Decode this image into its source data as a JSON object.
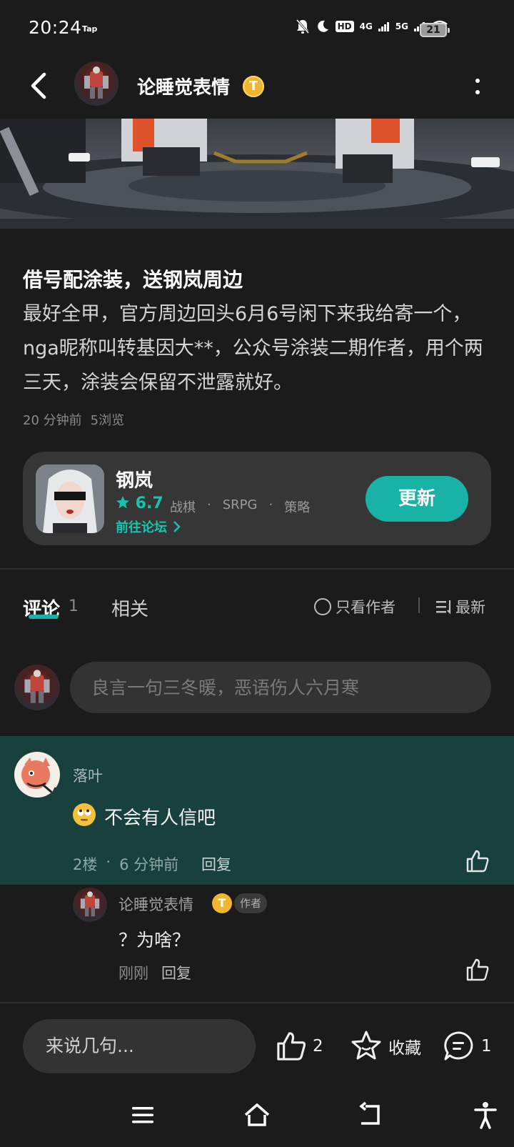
{
  "status_bar": {
    "time": "20:24",
    "tap": "Tap",
    "hd_badge": "HD",
    "net_4g": "4G",
    "net_5g": "5G",
    "battery": "21"
  },
  "header": {
    "title": "论睡觉表情",
    "badge": "T"
  },
  "post": {
    "title": "借号配涂装，送钢岚周边",
    "body": "最好全甲，官方周边回头6月6号闲下来我给寄一个，nga昵称叫转基因大**，公众号涂装二期作者，用个两三天，涂装会保留不泄露就好。",
    "time": "20 分钟前",
    "views": "5浏览"
  },
  "game_card": {
    "name": "钢岚",
    "rating": "6.7",
    "tags": [
      "战棋",
      "·",
      "SRPG",
      "·",
      "策略"
    ],
    "forum_link": "前往论坛",
    "update_button": "更新",
    "accent": "#18b3a6"
  },
  "tabs": {
    "comments_label": "评论",
    "comments_count": "1",
    "related_label": "相关",
    "author_only": "只看作者",
    "sort": "最新"
  },
  "comment_input": {
    "placeholder": "良言一句三冬暖，恶语伤人六月寒"
  },
  "comments": [
    {
      "user": "落叶",
      "emoji": "rolling-eyes-emoji",
      "text": "不会有人信吧",
      "floor": "2楼",
      "dot": "·",
      "time": "6 分钟前",
      "reply_label": "回复",
      "highlight_color": "#18403d",
      "reply": {
        "user": "论睡觉表情",
        "badge": "T",
        "author_tag": "作者",
        "text": "？为啥？",
        "time": "刚刚",
        "reply_label": "回复"
      }
    }
  ],
  "bottom_bar": {
    "input_label": "来说几句...",
    "likes": "2",
    "favorite_label": "收藏",
    "comments": "1"
  },
  "nav_icons": [
    "menu-icon",
    "home-icon",
    "back-icon",
    "accessibility-icon"
  ]
}
